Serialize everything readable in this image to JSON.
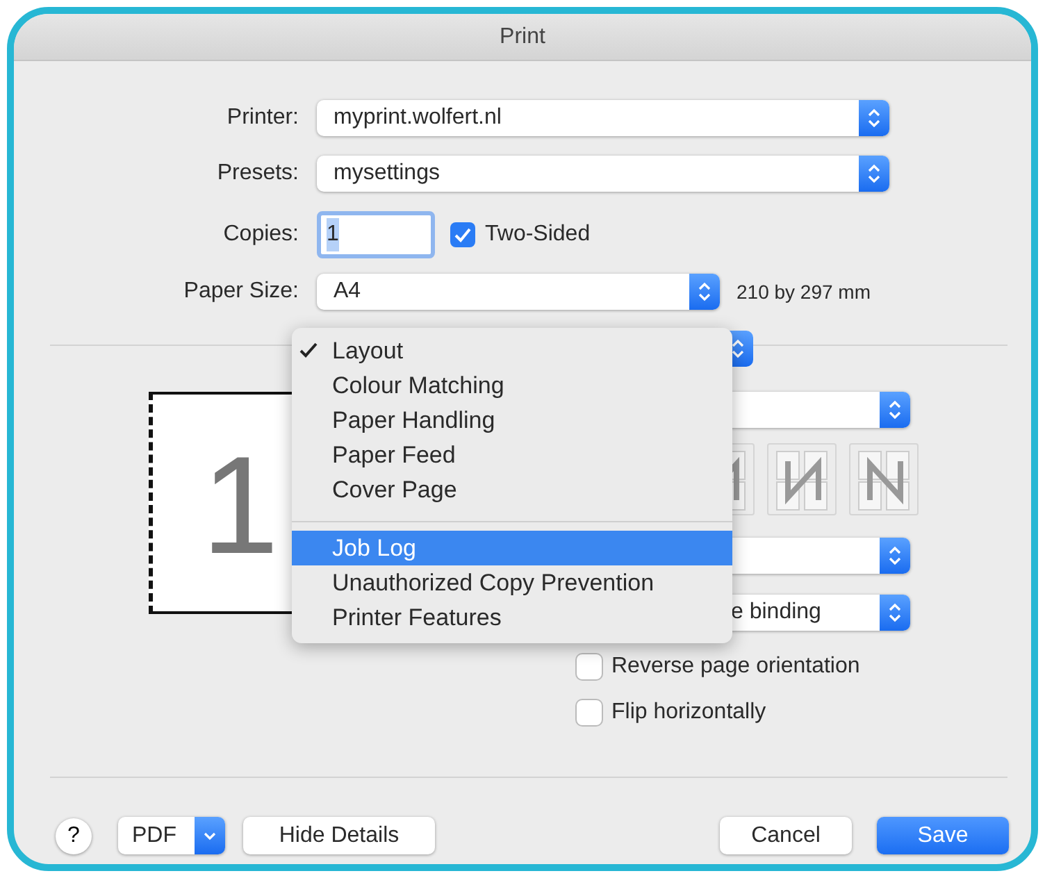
{
  "window": {
    "title": "Print"
  },
  "printer": {
    "label": "Printer:",
    "value": "myprint.wolfert.nl"
  },
  "presets": {
    "label": "Presets:",
    "value": "mysettings"
  },
  "copies": {
    "label": "Copies:",
    "value": "1"
  },
  "two_sided": {
    "label": "Two-Sided",
    "checked": true
  },
  "paper_size": {
    "label": "Paper Size:",
    "value": "A4",
    "dimensions": "210 by 297 mm"
  },
  "preview": {
    "page_number": "1"
  },
  "menu": {
    "groups": [
      [
        {
          "label": "Layout",
          "checked": true,
          "selected": false
        },
        {
          "label": "Colour Matching",
          "checked": false,
          "selected": false
        },
        {
          "label": "Paper Handling",
          "checked": false,
          "selected": false
        },
        {
          "label": "Paper Feed",
          "checked": false,
          "selected": false
        },
        {
          "label": "Cover Page",
          "checked": false,
          "selected": false
        }
      ],
      [
        {
          "label": "Job Log",
          "checked": false,
          "selected": true
        },
        {
          "label": "Unauthorized Copy Prevention",
          "checked": false,
          "selected": false
        },
        {
          "label": "Printer Features",
          "checked": false,
          "selected": false
        }
      ]
    ]
  },
  "binding_popup": {
    "value": "e binding"
  },
  "options": [
    {
      "label": "Reverse page orientation",
      "checked": false
    },
    {
      "label": "Flip horizontally",
      "checked": false
    }
  ],
  "footer": {
    "help": "?",
    "pdf": "PDF",
    "hide_details": "Hide Details",
    "cancel": "Cancel",
    "save": "Save"
  }
}
